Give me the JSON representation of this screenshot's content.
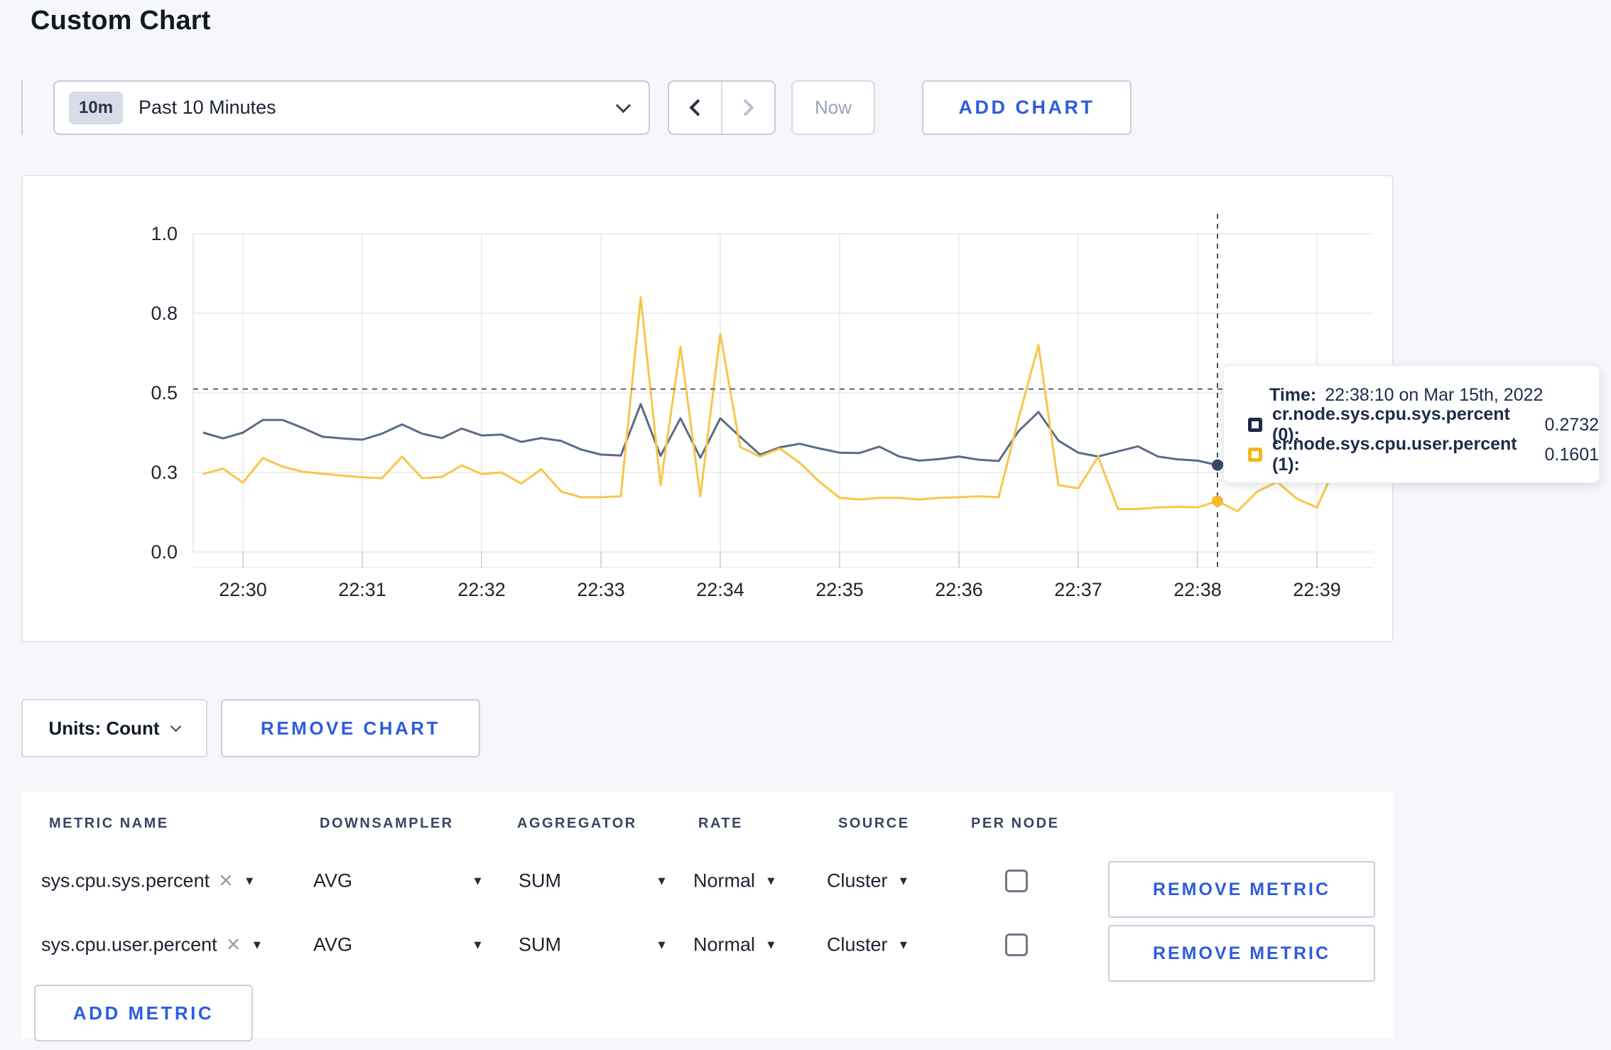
{
  "page": {
    "title": "Custom Chart"
  },
  "toolbar": {
    "time_range": {
      "badge": "10m",
      "label": "Past 10 Minutes"
    },
    "now_label": "Now",
    "add_chart_label": "ADD CHART"
  },
  "chart_data": {
    "type": "line",
    "title": "",
    "xlabel": "",
    "ylabel": "",
    "ylim": [
      0,
      1.0
    ],
    "grid": true,
    "y_tick_values": [
      0,
      0.25,
      0.5,
      0.75,
      1.0
    ],
    "y_tick_labels": [
      "0.0",
      "0.3",
      "0.5",
      "0.8",
      "1.0"
    ],
    "x_tick_labels": [
      "22:30",
      "22:31",
      "22:32",
      "22:33",
      "22:34",
      "22:35",
      "22:36",
      "22:37",
      "22:38",
      "22:39"
    ],
    "start_time": "22:29:40",
    "interval_seconds": 10,
    "series": [
      {
        "name": "cr.node.sys.cpu.sys.percent",
        "color": "#5b6b8a",
        "values": [
          0.375,
          0.357,
          0.375,
          0.415,
          0.415,
          0.39,
          0.362,
          0.357,
          0.353,
          0.372,
          0.401,
          0.372,
          0.358,
          0.388,
          0.366,
          0.369,
          0.346,
          0.358,
          0.349,
          0.322,
          0.306,
          0.303,
          0.465,
          0.302,
          0.42,
          0.296,
          0.42,
          0.362,
          0.306,
          0.329,
          0.34,
          0.325,
          0.312,
          0.311,
          0.331,
          0.3,
          0.287,
          0.292,
          0.3,
          0.29,
          0.286,
          0.38,
          0.44,
          0.35,
          0.312,
          0.3,
          0.316,
          0.332,
          0.3,
          0.291,
          0.287,
          0.2732,
          0.298,
          0.318,
          0.308,
          0.296,
          0.3,
          0.306,
          0.3
        ]
      },
      {
        "name": "cr.node.sys.cpu.user.percent",
        "color": "#f7c64a",
        "values": [
          0.245,
          0.262,
          0.218,
          0.295,
          0.268,
          0.252,
          0.246,
          0.24,
          0.235,
          0.232,
          0.3,
          0.232,
          0.236,
          0.272,
          0.245,
          0.25,
          0.215,
          0.26,
          0.19,
          0.172,
          0.172,
          0.175,
          0.8,
          0.21,
          0.645,
          0.175,
          0.685,
          0.33,
          0.3,
          0.325,
          0.28,
          0.22,
          0.17,
          0.165,
          0.17,
          0.17,
          0.165,
          0.17,
          0.172,
          0.175,
          0.172,
          0.42,
          0.65,
          0.21,
          0.2,
          0.3,
          0.135,
          0.135,
          0.14,
          0.142,
          0.14,
          0.1601,
          0.128,
          0.19,
          0.22,
          0.167,
          0.14,
          0.28,
          0.24
        ]
      }
    ],
    "hover": {
      "index": 51,
      "guideline_y": 0.512,
      "time_prefix": "Time:",
      "time_label": "22:38:10 on Mar 15th, 2022",
      "points": [
        {
          "label": "cr.node.sys.cpu.sys.percent (0):",
          "value": "0.2732"
        },
        {
          "label": "cr.node.sys.cpu.user.percent (1):",
          "value": "0.1601"
        }
      ]
    }
  },
  "chart_controls": {
    "units_label": "Units: Count",
    "remove_chart_label": "REMOVE CHART"
  },
  "metrics_table": {
    "columns": [
      "METRIC NAME",
      "DOWNSAMPLER",
      "AGGREGATOR",
      "RATE",
      "SOURCE",
      "PER NODE"
    ],
    "rows": [
      {
        "metric_name": "sys.cpu.sys.percent",
        "downsampler": "AVG",
        "aggregator": "SUM",
        "rate": "Normal",
        "source": "Cluster",
        "per_node": false,
        "remove_label": "REMOVE METRIC"
      },
      {
        "metric_name": "sys.cpu.user.percent",
        "downsampler": "AVG",
        "aggregator": "SUM",
        "rate": "Normal",
        "source": "Cluster",
        "per_node": false,
        "remove_label": "REMOVE METRIC"
      }
    ],
    "add_metric_label": "ADD METRIC"
  }
}
